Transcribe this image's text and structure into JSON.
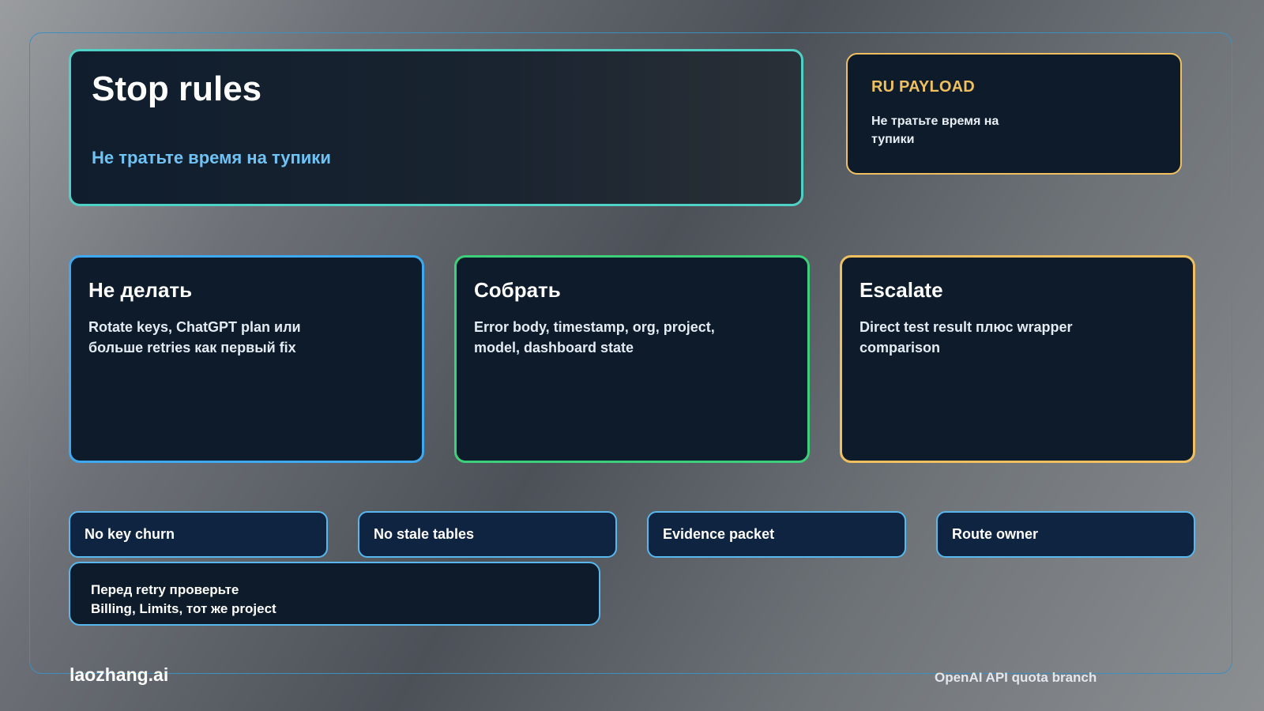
{
  "hero": {
    "title": "Stop rules",
    "subtitle": "Не тратьте время на тупики"
  },
  "payload": {
    "label": "RU PAYLOAD",
    "text": "Не тратьте время на тупики"
  },
  "cards": [
    {
      "title": "Не делать",
      "body": "Rotate keys, ChatGPT plan или больше retries как первый fix"
    },
    {
      "title": "Собрать",
      "body": "Error body, timestamp, org, project, model, dashboard state"
    },
    {
      "title": "Escalate",
      "body": "Direct test result плюс wrapper comparison"
    }
  ],
  "tags": [
    "No key churn",
    "No stale tables",
    "Evidence packet",
    "Route owner"
  ],
  "note": {
    "line1": "Перед retry проверьте",
    "line2": "Billing, Limits, тот же project"
  },
  "footer": {
    "brand": "laozhang.ai",
    "caption": "OpenAI API quota branch"
  },
  "colors": {
    "teal_border": "#4fd1c5",
    "blue_border": "#3ea8f0",
    "green_border": "#3dd07a",
    "amber_border": "#f0c060",
    "card_bg": "#0d1b2a"
  }
}
